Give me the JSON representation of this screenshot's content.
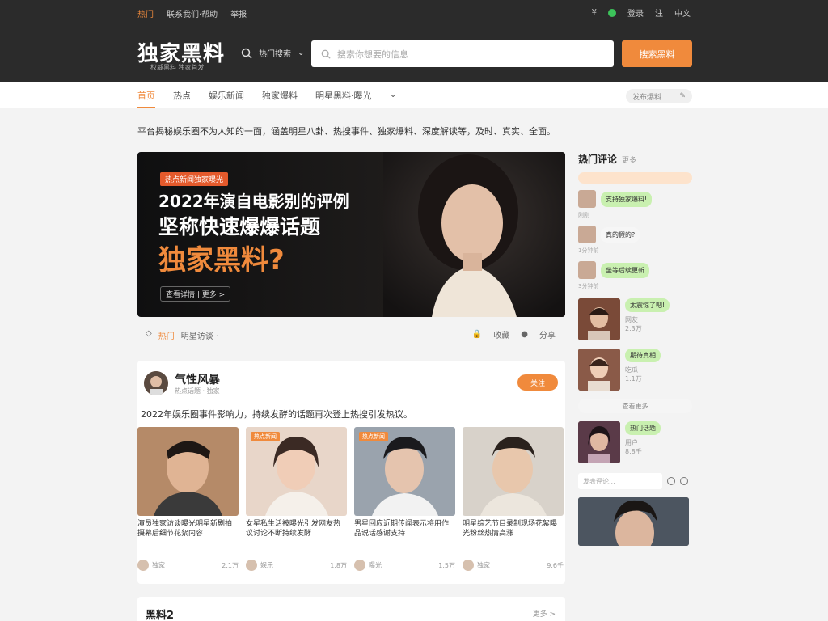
{
  "top": {
    "left_items": [
      "热门",
      "联系我们·帮助",
      "举报"
    ],
    "right_items": [
      "¥",
      "登录",
      "注",
      "中文"
    ]
  },
  "brand": {
    "logo": "独家黑料",
    "sub": "权威黑料 独家首发"
  },
  "search": {
    "toggle_label": "热门搜索",
    "placeholder": "搜索你想要的信息",
    "button": "搜索黑料"
  },
  "nav": {
    "items": [
      "首页",
      "热点",
      "娱乐新闻",
      "独家爆料",
      "明星黑料·曝光"
    ],
    "pill": "发布爆料"
  },
  "description": "平台揭秘娱乐圈不为人知的一面，涵盖明星八卦、热搜事件、独家爆料、深度解读等，及时、真实、全面。",
  "hero": {
    "badge": "热点新闻独家曝光",
    "line1": "2022年演自电影别的评例",
    "line2": "坚称快速爆爆话题",
    "line3": "独家黑料?",
    "tag": "查看详情 | 更多 >"
  },
  "hero_footer": {
    "left": [
      "热门",
      "明星访谈 ·"
    ],
    "right": [
      "收藏",
      "分享"
    ]
  },
  "hot": {
    "title": "气性风暴",
    "subtitle": "热点话题 · 独家",
    "follow": "关注",
    "desc": "2022年娱乐圈事件影响力，持续发酵的话题再次登上热搜引发热议。",
    "tiles": [
      {
        "label": "",
        "text": "演员独家访谈曝光明星新剧拍摄幕后细节花絮内容",
        "author": "独家",
        "count": "2.1万"
      },
      {
        "label": "热点新闻",
        "text": "女星私生活被曝光引发网友热议讨论不断持续发酵",
        "author": "娱乐",
        "count": "1.8万"
      },
      {
        "label": "热点新闻",
        "text": "男星回应近期传闻表示将用作品说话感谢支持",
        "author": "曝光",
        "count": "1.5万"
      },
      {
        "label": "",
        "text": "明星综艺节目录制现场花絮曝光粉丝热情高涨",
        "author": "独家",
        "count": "9.6千"
      }
    ]
  },
  "next_section": {
    "title": "黑料2",
    "more": "更多 >"
  },
  "sidebar": {
    "title": "热门评论",
    "more": "更多",
    "comments": [
      {
        "text": "支持独家爆料!",
        "time": "刚刚"
      },
      {
        "text": "真的假的?",
        "time": "1分钟前"
      },
      {
        "text": "坐等后续更新",
        "time": "3分钟前"
      }
    ],
    "videos": [
      {
        "bubble": "太震惊了吧!",
        "author": "网友",
        "views": "2.3万"
      },
      {
        "bubble": "期待真相",
        "author": "吃瓜",
        "views": "1.1万"
      }
    ],
    "more_btn": "查看更多",
    "video3": {
      "bubble": "热门话题",
      "author": "用户",
      "views": "8.8千"
    },
    "input_placeholder": "发表评论..."
  }
}
